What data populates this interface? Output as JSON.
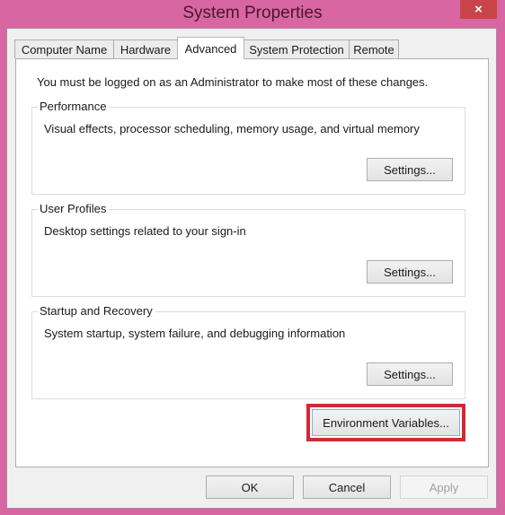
{
  "window": {
    "title": "System Properties",
    "close_icon": "×"
  },
  "tabs": [
    {
      "label": "Computer Name",
      "active": false
    },
    {
      "label": "Hardware",
      "active": false
    },
    {
      "label": "Advanced",
      "active": true
    },
    {
      "label": "System Protection",
      "active": false
    },
    {
      "label": "Remote",
      "active": false
    }
  ],
  "advanced": {
    "admin_note": "You must be logged on as an Administrator to make most of these changes.",
    "groups": [
      {
        "title": "Performance",
        "description": "Visual effects, processor scheduling, memory usage, and virtual memory",
        "button": "Settings..."
      },
      {
        "title": "User Profiles",
        "description": "Desktop settings related to your sign-in",
        "button": "Settings..."
      },
      {
        "title": "Startup and Recovery",
        "description": "System startup, system failure, and debugging information",
        "button": "Settings..."
      }
    ],
    "env_button": "Environment Variables...",
    "highlight_color": "#cf2a35"
  },
  "footer": {
    "ok": "OK",
    "cancel": "Cancel",
    "apply": "Apply"
  }
}
